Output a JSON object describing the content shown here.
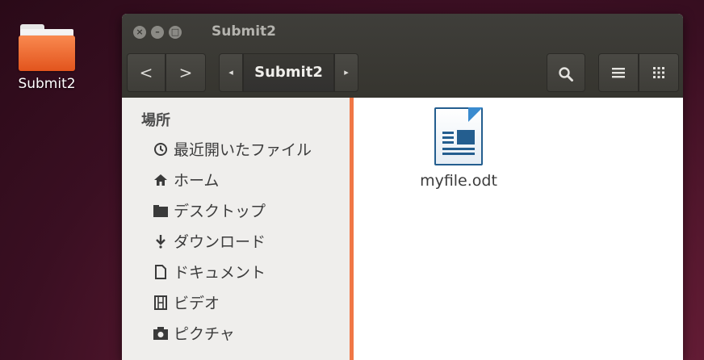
{
  "desktop": {
    "icon_label": "Submit2"
  },
  "window": {
    "title": "Submit2",
    "buttons": {
      "close": "×",
      "minimize": "–",
      "maximize": "□"
    },
    "toolbar": {
      "back": "<",
      "forward": ">",
      "path_left_arrow": "◂",
      "path_current": "Submit2",
      "path_right_arrow": "▸",
      "search_icon": "search-icon",
      "list_view_icon": "list-view-icon",
      "grid_view_icon": "grid-view-icon"
    },
    "sidebar": {
      "heading": "場所",
      "items": [
        {
          "label": "最近開いたファイル",
          "icon": "clock-icon",
          "glyph": "⏲"
        },
        {
          "label": "ホーム",
          "icon": "home-icon",
          "glyph": "⌂"
        },
        {
          "label": "デスクトップ",
          "icon": "folder-icon",
          "glyph": "■"
        },
        {
          "label": "ダウンロード",
          "icon": "download-icon",
          "glyph": "⇣"
        },
        {
          "label": "ドキュメント",
          "icon": "document-icon",
          "glyph": "▯"
        },
        {
          "label": "ビデオ",
          "icon": "video-icon",
          "glyph": "▤"
        },
        {
          "label": "ピクチャ",
          "icon": "camera-icon",
          "glyph": "◙"
        }
      ]
    },
    "files": [
      {
        "name": "myfile.odt",
        "icon": "odt-document-icon"
      }
    ]
  },
  "colors": {
    "accent": "#f07746",
    "folder": "#e2541d",
    "doc_blue": "#245e8f"
  }
}
